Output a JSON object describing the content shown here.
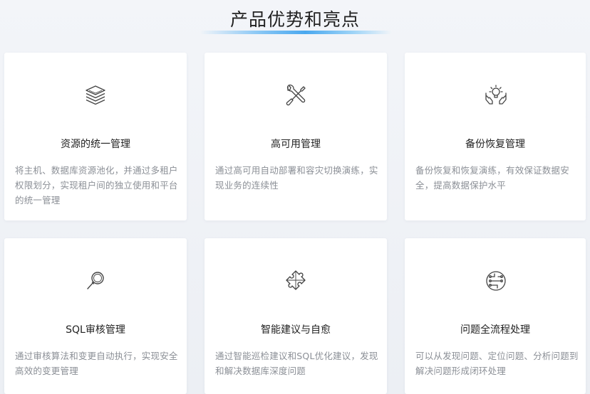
{
  "section": {
    "title": "产品优势和亮点"
  },
  "cards": [
    {
      "icon": "layers-icon",
      "title": "资源的统一管理",
      "desc": "将主机、数据库资源池化，并通过多租户权限划分，实现租户间的独立使用和平台的统一管理"
    },
    {
      "icon": "wrench-screwdriver-icon",
      "title": "高可用管理",
      "desc": "通过高可用自动部署和容灾切换演练，实现业务的连续性"
    },
    {
      "icon": "lightbulb-hands-icon",
      "title": "备份恢复管理",
      "desc": "备份恢复和恢复演练，有效保证数据安全，提高数据保护水平"
    },
    {
      "icon": "magnifier-icon",
      "title": "SQL审核管理",
      "desc": "通过审核算法和变更自动执行，实现安全高效的变更管理"
    },
    {
      "icon": "puzzle-icon",
      "title": "智能建议与自愈",
      "desc": "通过智能巡检建议和SQL优化建议，发现和解决数据库深度问题"
    },
    {
      "icon": "circuit-icon",
      "title": "问题全流程处理",
      "desc": "可以从发现问题、定位问题、分析问题到解决问题形成闭环处理"
    }
  ]
}
